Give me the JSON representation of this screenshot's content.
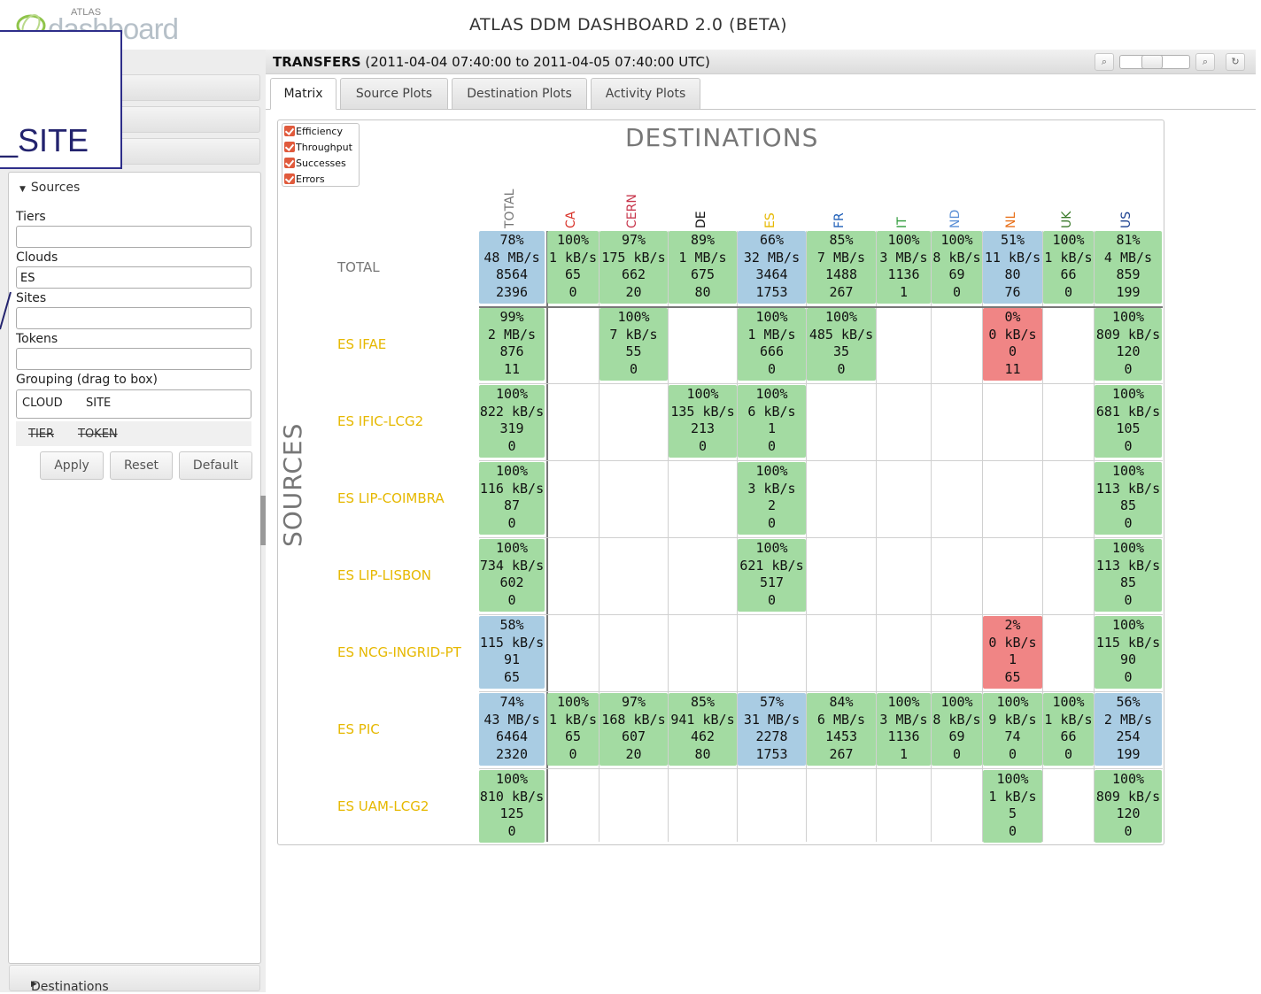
{
  "header": {
    "logo_small": "ATLAS",
    "logo_word": "dashboard",
    "title": "ATLAS DDM DASHBOARD 2.0 (BETA)"
  },
  "annotation": {
    "text": "_SITE"
  },
  "sidebar": {
    "sources_label": "Sources",
    "tiers_label": "Tiers",
    "tiers_value": "",
    "clouds_label": "Clouds",
    "clouds_value": "ES",
    "sites_label": "Sites",
    "sites_value": "",
    "tokens_label": "Tokens",
    "tokens_value": "",
    "grouping_label": "Grouping (drag to box)",
    "grouping_selected": [
      "CLOUD",
      "SITE"
    ],
    "grouping_available": [
      "TIER",
      "TOKEN"
    ],
    "apply": "Apply",
    "reset": "Reset",
    "default": "Default",
    "destinations_label": "Destinations"
  },
  "toolbar": {
    "title_bold": "TRANSFERS",
    "title_range": "(2011-04-04 07:40:00 to 2011-04-05 07:40:00 UTC)"
  },
  "tabs": [
    "Matrix",
    "Source Plots",
    "Destination Plots",
    "Activity Plots"
  ],
  "legend": [
    "Efficiency",
    "Throughput",
    "Successes",
    "Errors"
  ],
  "matrix": {
    "dest_title": "DESTINATIONS",
    "src_title": "SOURCES",
    "columns": [
      {
        "name": "TOTAL",
        "color": "#777777"
      },
      {
        "name": "CA",
        "color": "#d9342b"
      },
      {
        "name": "CERN",
        "color": "#c8374d"
      },
      {
        "name": "DE",
        "color": "#111111"
      },
      {
        "name": "ES",
        "color": "#e6b800"
      },
      {
        "name": "FR",
        "color": "#1f5fb8"
      },
      {
        "name": "IT",
        "color": "#2e9b3a"
      },
      {
        "name": "ND",
        "color": "#5b8fd6"
      },
      {
        "name": "NL",
        "color": "#e8701a"
      },
      {
        "name": "UK",
        "color": "#3a7a2a"
      },
      {
        "name": "US",
        "color": "#1a3f8f"
      }
    ],
    "rows": [
      {
        "name": "TOTAL",
        "color": "#777777",
        "cells": [
          [
            "78%",
            "48 MB/s",
            "8564",
            "2396",
            "b"
          ],
          [
            "100%",
            "1 kB/s",
            "65",
            "0",
            "g"
          ],
          [
            "97%",
            "175 kB/s",
            "662",
            "20",
            "g"
          ],
          [
            "89%",
            "1 MB/s",
            "675",
            "80",
            "g"
          ],
          [
            "66%",
            "32 MB/s",
            "3464",
            "1753",
            "b"
          ],
          [
            "85%",
            "7 MB/s",
            "1488",
            "267",
            "g"
          ],
          [
            "100%",
            "3 MB/s",
            "1136",
            "1",
            "g"
          ],
          [
            "100%",
            "8 kB/s",
            "69",
            "0",
            "g"
          ],
          [
            "51%",
            "11 kB/s",
            "80",
            "76",
            "b"
          ],
          [
            "100%",
            "1 kB/s",
            "66",
            "0",
            "g"
          ],
          [
            "81%",
            "4 MB/s",
            "859",
            "199",
            "g"
          ]
        ]
      },
      {
        "name": "ES IFAE",
        "color": "#e6b800",
        "cells": [
          [
            "99%",
            "2 MB/s",
            "876",
            "11",
            "g"
          ],
          null,
          [
            "100%",
            "7 kB/s",
            "55",
            "0",
            "g"
          ],
          null,
          [
            "100%",
            "1 MB/s",
            "666",
            "0",
            "g"
          ],
          [
            "100%",
            "485 kB/s",
            "35",
            "0",
            "g"
          ],
          null,
          null,
          [
            "0%",
            "0 kB/s",
            "0",
            "11",
            "r"
          ],
          null,
          [
            "100%",
            "809 kB/s",
            "120",
            "0",
            "g"
          ]
        ]
      },
      {
        "name": "ES IFIC-LCG2",
        "color": "#e6b800",
        "cells": [
          [
            "100%",
            "822 kB/s",
            "319",
            "0",
            "g"
          ],
          null,
          null,
          [
            "100%",
            "135 kB/s",
            "213",
            "0",
            "g"
          ],
          [
            "100%",
            "6 kB/s",
            "1",
            "0",
            "g"
          ],
          null,
          null,
          null,
          null,
          null,
          [
            "100%",
            "681 kB/s",
            "105",
            "0",
            "g"
          ]
        ]
      },
      {
        "name": "ES LIP-COIMBRA",
        "color": "#e6b800",
        "cells": [
          [
            "100%",
            "116 kB/s",
            "87",
            "0",
            "g"
          ],
          null,
          null,
          null,
          [
            "100%",
            "3 kB/s",
            "2",
            "0",
            "g"
          ],
          null,
          null,
          null,
          null,
          null,
          [
            "100%",
            "113 kB/s",
            "85",
            "0",
            "g"
          ]
        ]
      },
      {
        "name": "ES LIP-LISBON",
        "color": "#e6b800",
        "cells": [
          [
            "100%",
            "734 kB/s",
            "602",
            "0",
            "g"
          ],
          null,
          null,
          null,
          [
            "100%",
            "621 kB/s",
            "517",
            "0",
            "g"
          ],
          null,
          null,
          null,
          null,
          null,
          [
            "100%",
            "113 kB/s",
            "85",
            "0",
            "g"
          ]
        ]
      },
      {
        "name": "ES NCG-INGRID-PT",
        "color": "#e6b800",
        "cells": [
          [
            "58%",
            "115 kB/s",
            "91",
            "65",
            "b"
          ],
          null,
          null,
          null,
          null,
          null,
          null,
          null,
          [
            "2%",
            "0 kB/s",
            "1",
            "65",
            "r"
          ],
          null,
          [
            "100%",
            "115 kB/s",
            "90",
            "0",
            "g"
          ]
        ]
      },
      {
        "name": "ES PIC",
        "color": "#e6b800",
        "cells": [
          [
            "74%",
            "43 MB/s",
            "6464",
            "2320",
            "b"
          ],
          [
            "100%",
            "1 kB/s",
            "65",
            "0",
            "g"
          ],
          [
            "97%",
            "168 kB/s",
            "607",
            "20",
            "g"
          ],
          [
            "85%",
            "941 kB/s",
            "462",
            "80",
            "g"
          ],
          [
            "57%",
            "31 MB/s",
            "2278",
            "1753",
            "b"
          ],
          [
            "84%",
            "6 MB/s",
            "1453",
            "267",
            "g"
          ],
          [
            "100%",
            "3 MB/s",
            "1136",
            "1",
            "g"
          ],
          [
            "100%",
            "8 kB/s",
            "69",
            "0",
            "g"
          ],
          [
            "100%",
            "9 kB/s",
            "74",
            "0",
            "g"
          ],
          [
            "100%",
            "1 kB/s",
            "66",
            "0",
            "g"
          ],
          [
            "56%",
            "2 MB/s",
            "254",
            "199",
            "b"
          ]
        ]
      },
      {
        "name": "ES UAM-LCG2",
        "color": "#e6b800",
        "cells": [
          [
            "100%",
            "810 kB/s",
            "125",
            "0",
            "g"
          ],
          null,
          null,
          null,
          null,
          null,
          null,
          null,
          [
            "100%",
            "1 kB/s",
            "5",
            "0",
            "g"
          ],
          null,
          [
            "100%",
            "809 kB/s",
            "120",
            "0",
            "g"
          ]
        ]
      }
    ]
  }
}
